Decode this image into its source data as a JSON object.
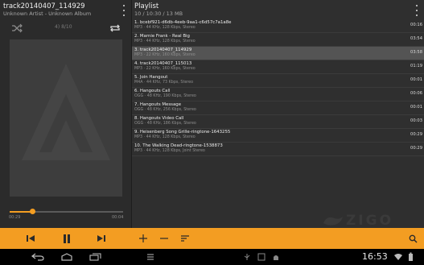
{
  "now_playing": {
    "title": "track20140407_114929",
    "subtitle": "Unknown Artist - Unknown Album",
    "volume_text": "4) 8/10",
    "time_current": "00:29",
    "time_total": "00:04",
    "progress_fraction": 0.2
  },
  "playlist": {
    "title": "Playlist",
    "summary": "10 / 10:30 / 13 MB",
    "items": [
      {
        "name": "1. bcebf921-d6db-4eeb-9aa1-c6d57c7a1a8e",
        "meta": "MP3 · 44 KHz, 128 Kbps, Stereo",
        "duration": "00:16",
        "selected": false
      },
      {
        "name": "2. Marnie Frank - Real Big",
        "meta": "MP3 · 44 KHz, 128 Kbps, Stereo",
        "duration": "03:54",
        "selected": false
      },
      {
        "name": "3. track20140407_114929",
        "meta": "MP3 · 22 KHz, 160 Kbps, Stereo",
        "duration": "03:58",
        "selected": true
      },
      {
        "name": "4. track20140407_115013",
        "meta": "MP3 · 22 KHz, 160 Kbps, Stereo",
        "duration": "01:19",
        "selected": false
      },
      {
        "name": "5. Join Hangout",
        "meta": "M4A · 44 KHz, 73 Kbps, Stereo",
        "duration": "00:01",
        "selected": false
      },
      {
        "name": "6. Hangouts Call",
        "meta": "OGG · 48 KHz, 190 Kbps, Stereo",
        "duration": "00:06",
        "selected": false
      },
      {
        "name": "7. Hangouts Message",
        "meta": "OGG · 48 KHz, 256 Kbps, Stereo",
        "duration": "00:01",
        "selected": false
      },
      {
        "name": "8. Hangouts Video Call",
        "meta": "OGG · 48 KHz, 186 Kbps, Stereo",
        "duration": "00:03",
        "selected": false
      },
      {
        "name": "9. Heisenberg Song Grille-ringtone-1643255",
        "meta": "MP3 · 44 KHz, 128 Kbps, Stereo",
        "duration": "00:29",
        "selected": false
      },
      {
        "name": "10. The Walking Dead-ringtone-1538873",
        "meta": "MP3 · 44 KHz, 128 Kbps, Joint Stereo",
        "duration": "00:29",
        "selected": false
      }
    ]
  },
  "watermark_text": "ZIGO",
  "status": {
    "clock": "16:53"
  },
  "colors": {
    "accent": "#f39d22",
    "selected_row": "#545454",
    "background": "#2f2f2f"
  },
  "icons": {
    "left_menu": "overflow-menu-icon",
    "shuffle": "shuffle-icon",
    "repeat": "repeat-icon",
    "album_art": "aimp-logo-icon",
    "prev": "skip-previous-icon",
    "pause": "pause-icon",
    "next": "skip-next-icon",
    "add": "add-icon",
    "remove": "remove-icon",
    "sort": "sort-icon",
    "search": "search-icon"
  }
}
